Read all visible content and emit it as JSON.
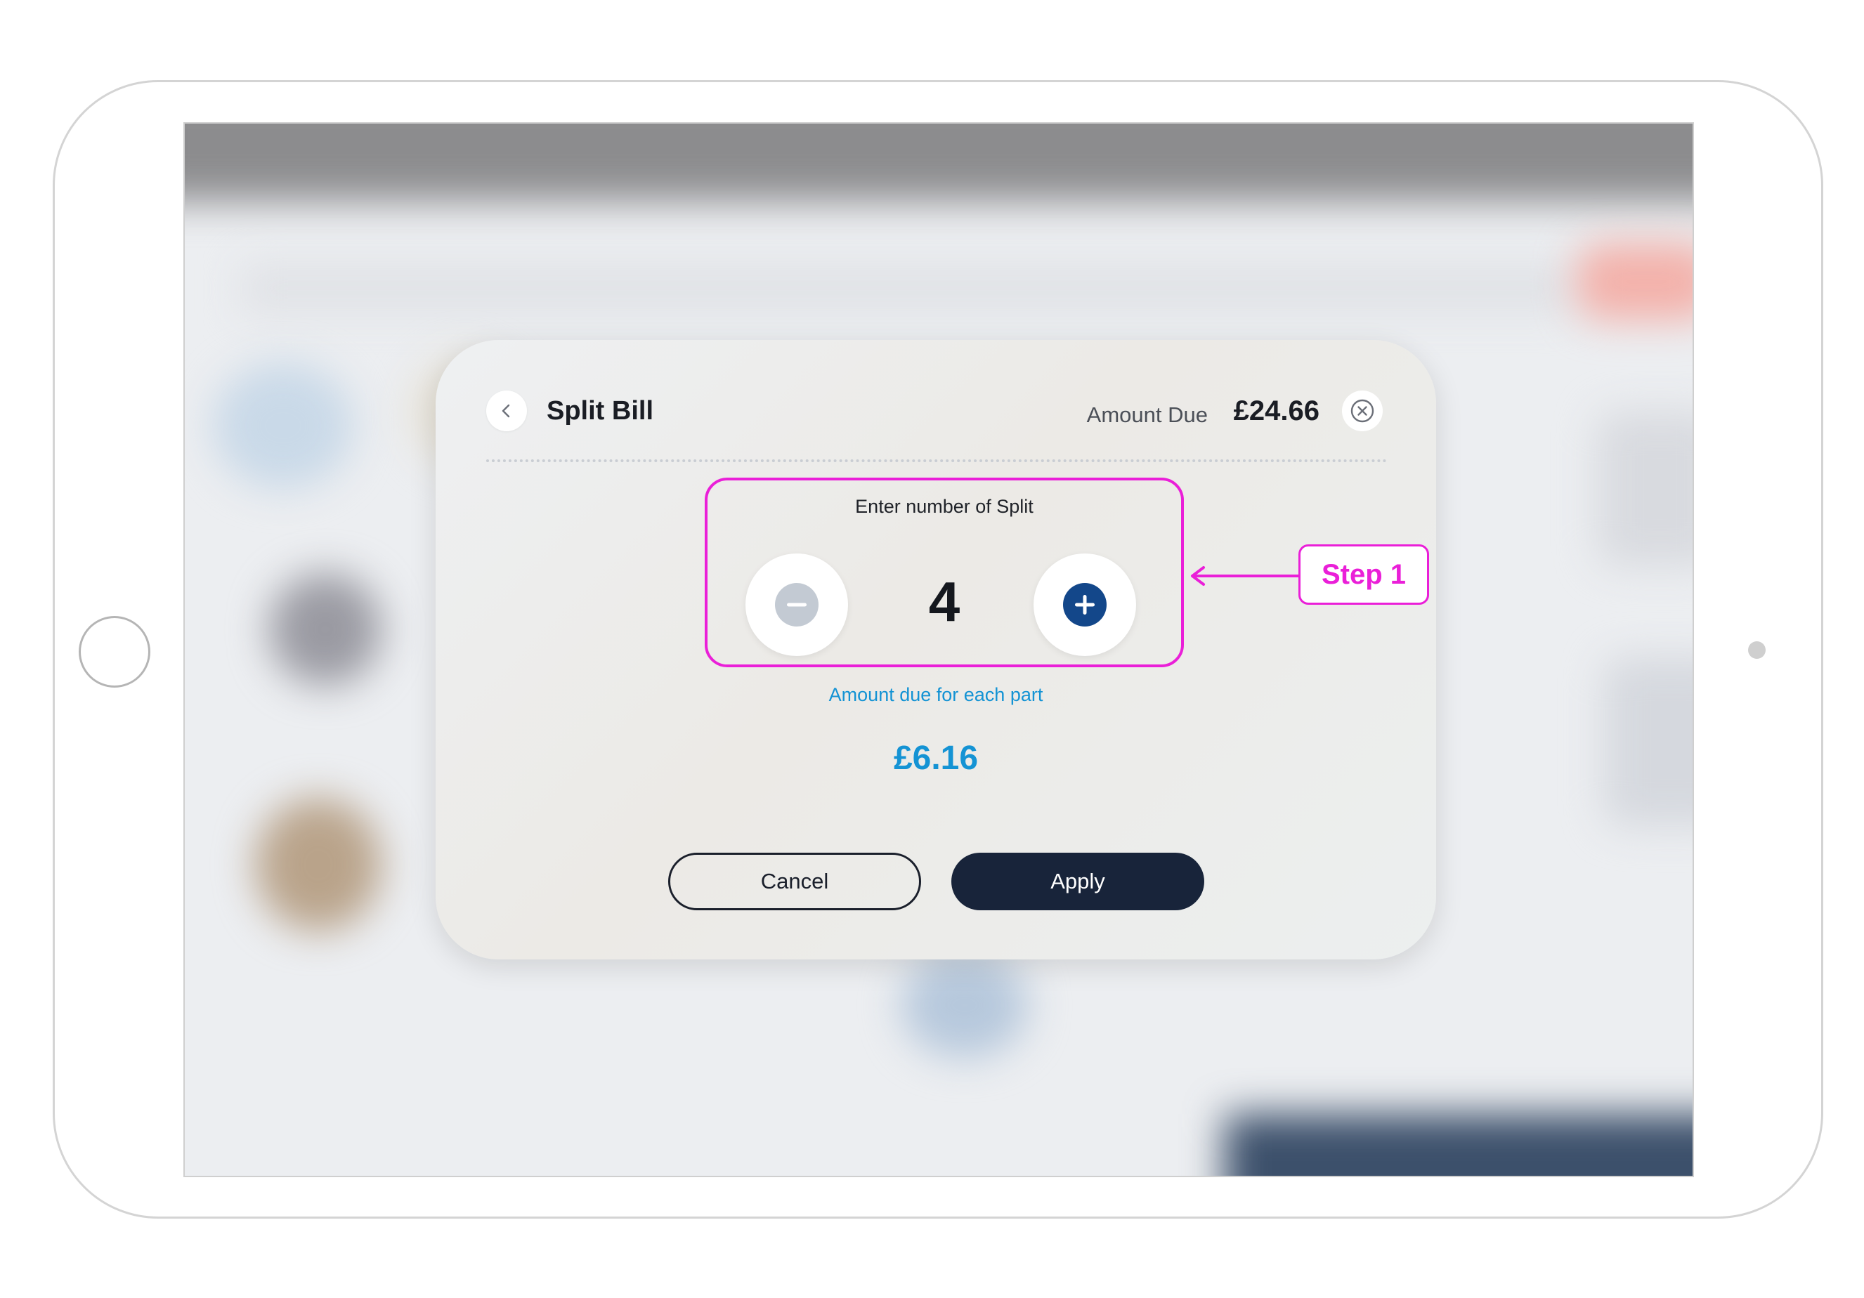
{
  "modal": {
    "title": "Split Bill",
    "amount_due_label": "Amount Due",
    "amount_due_value": "£24.66"
  },
  "split": {
    "label": "Enter number of Split",
    "count": "4",
    "each_part_label": "Amount due for each part",
    "each_part_value": "£6.16"
  },
  "actions": {
    "cancel_label": "Cancel",
    "apply_label": "Apply"
  },
  "annotation": {
    "step_label": "Step 1"
  },
  "icons": {
    "back": "chevron-left-icon",
    "close": "close-circle-icon",
    "decrement": "minus-icon",
    "increment": "plus-icon"
  },
  "colors": {
    "accent_blue": "#1493d4",
    "plus_blue": "#13478a",
    "minus_disabled": "#c3cad3",
    "dark_button": "#18243a",
    "annotation_magenta": "#ea1fd8"
  }
}
